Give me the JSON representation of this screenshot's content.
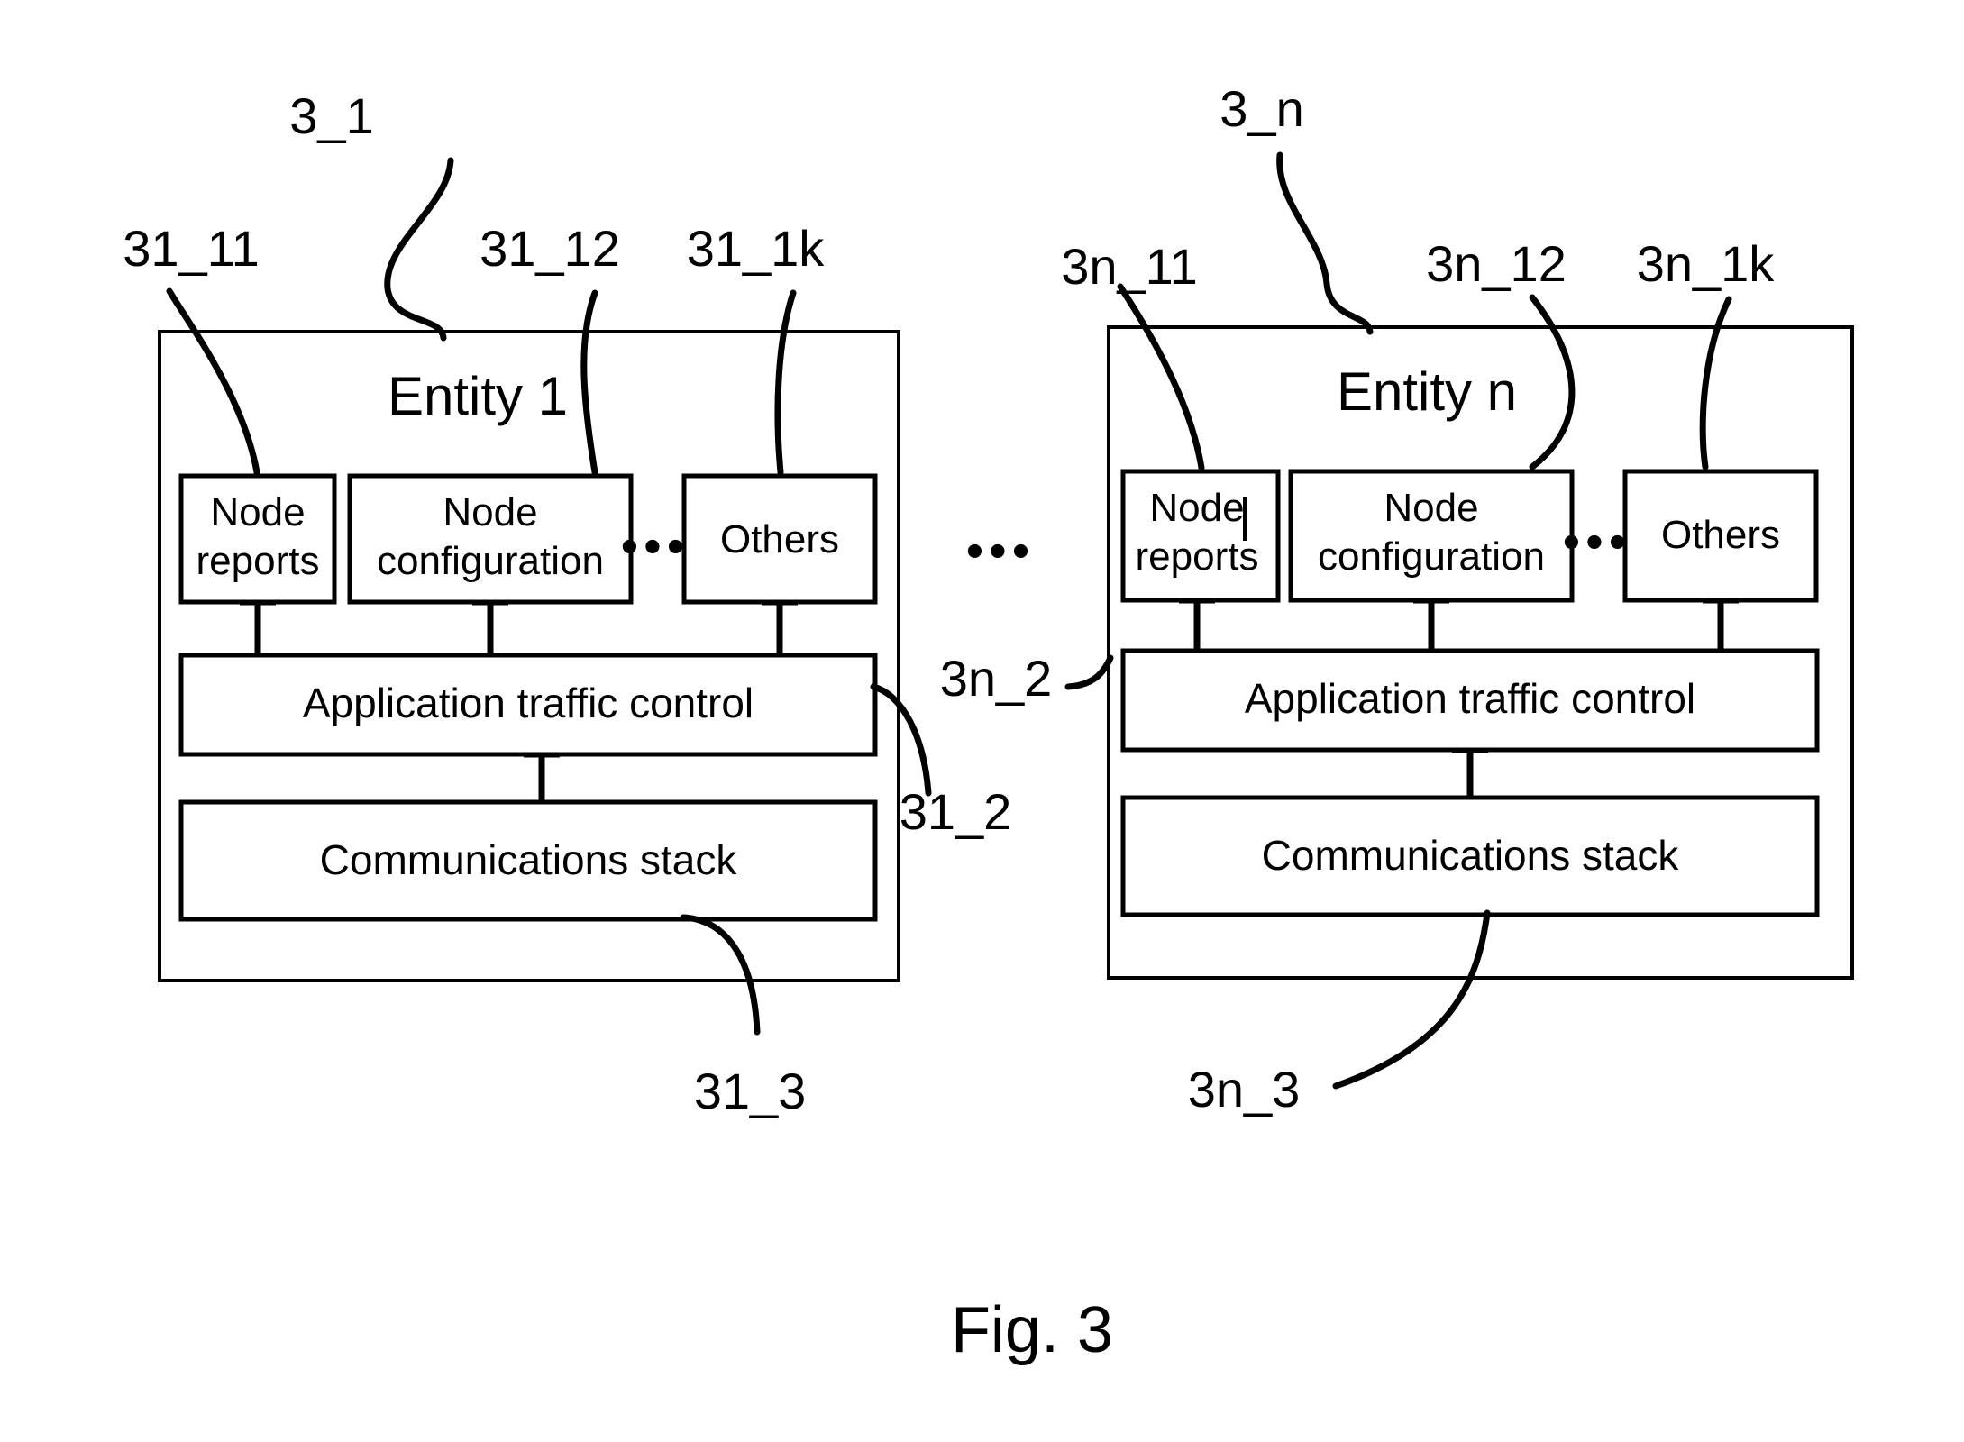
{
  "figure": {
    "caption": "Fig. 3"
  },
  "entities": [
    {
      "id": "entity-1",
      "title": "Entity 1",
      "ref_label": "3_1",
      "modules": [
        {
          "label": "Node\nreports",
          "line1": "Node",
          "line2": "reports",
          "ref_label": "31_11"
        },
        {
          "label": "Node\nconfiguration",
          "line1": "Node",
          "line2": "configuration",
          "ref_label": "31_12"
        },
        {
          "label": "Others",
          "line1": "Others",
          "line2": "",
          "ref_label": "31_1k"
        }
      ],
      "module_ellipsis": "•••",
      "traffic_control": {
        "label": "Application traffic control",
        "ref_label": "31_2"
      },
      "comms_stack": {
        "label": "Communications stack",
        "ref_label": "31_3"
      }
    },
    {
      "id": "entity-n",
      "title": "Entity n",
      "ref_label": "3_n",
      "modules": [
        {
          "label": "Node\nreports",
          "line1": "Node",
          "line2": "reports",
          "ref_label": "3n_11"
        },
        {
          "label": "Node\nconfiguration",
          "line1": "Node",
          "line2": "configuration",
          "ref_label": "3n_12"
        },
        {
          "label": "Others",
          "line1": "Others",
          "line2": "",
          "ref_label": "3n_1k"
        }
      ],
      "module_ellipsis": "•••",
      "traffic_control": {
        "label": "Application traffic control",
        "ref_label": "3n_2"
      },
      "comms_stack": {
        "label": "Communications stack",
        "ref_label": "3n_3"
      }
    }
  ],
  "between_entities_ellipsis": "•••",
  "colors": {
    "stroke": "#000000",
    "background": "#ffffff"
  }
}
